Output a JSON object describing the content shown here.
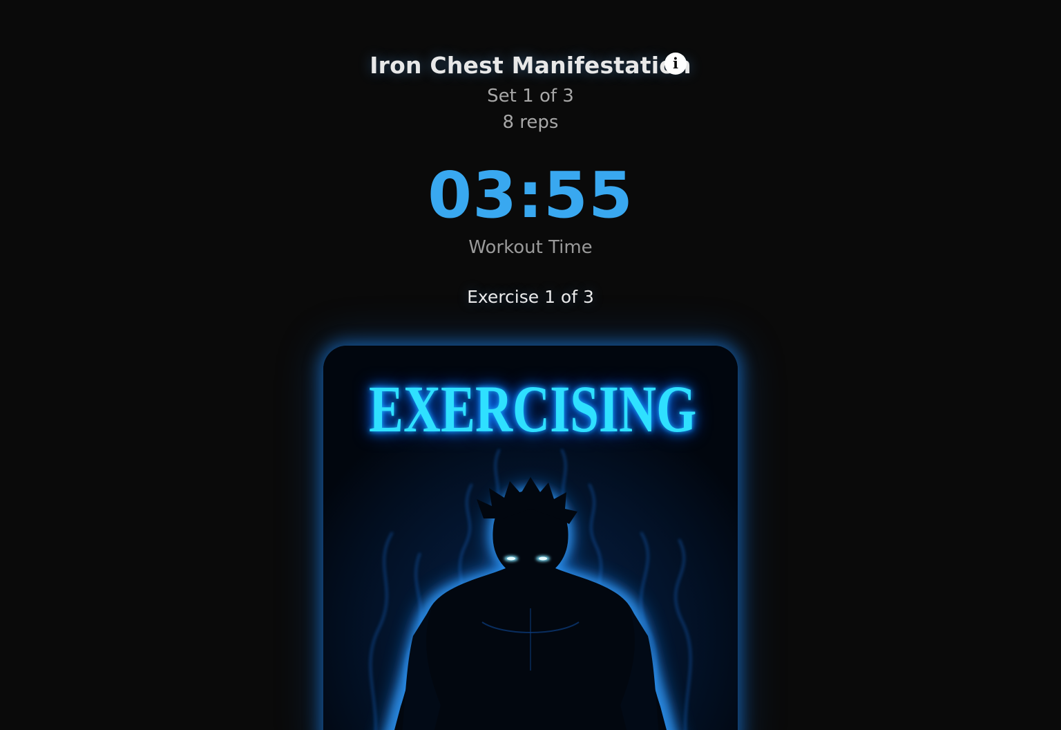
{
  "workout": {
    "title": "Iron Chest Manifestation",
    "info_icon": "info-icon",
    "set_text": "Set 1 of 3",
    "reps_text": "8 reps"
  },
  "timer": {
    "value": "03:55",
    "label": "Workout Time"
  },
  "exercise": {
    "progress_text": "Exercise 1 of 3"
  },
  "card": {
    "status_text": "EXERCISING",
    "image": "glowing-silhouette-figure-illustration"
  },
  "colors": {
    "background": "#0a0a0a",
    "accent": "#39a8f0",
    "card_glow": "#1e82e6",
    "card_title": "#2fe0ff"
  }
}
